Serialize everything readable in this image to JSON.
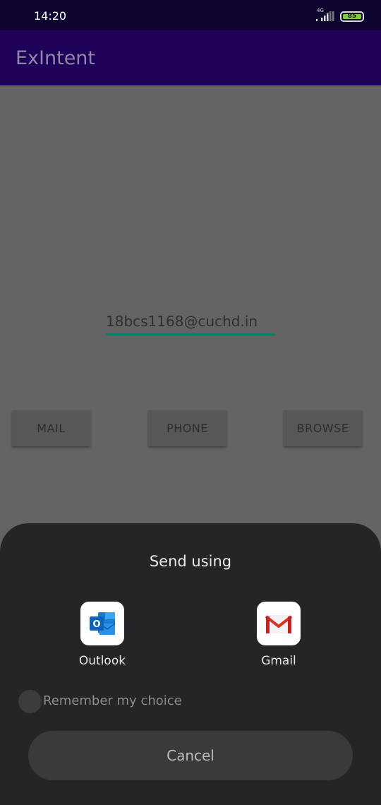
{
  "status_bar": {
    "time": "14:20",
    "network": "4G",
    "battery_level": "85",
    "battery_color": "#7ccf3a",
    "icons": [
      "signal-icon",
      "battery-icon"
    ]
  },
  "app_bar": {
    "title": "ExIntent",
    "color": "#200159"
  },
  "form": {
    "email_value": "18bcs1168@cuchd.in",
    "buttons": {
      "mail": "MAIL",
      "phone": "PHONE",
      "browse": "BROWSE"
    }
  },
  "chooser": {
    "title": "Send using",
    "apps": [
      {
        "label": "Outlook",
        "icon": "outlook-icon"
      },
      {
        "label": "Gmail",
        "icon": "gmail-icon"
      }
    ],
    "remember_label": "Remember my choice",
    "remember_checked": false,
    "cancel_label": "Cancel"
  }
}
